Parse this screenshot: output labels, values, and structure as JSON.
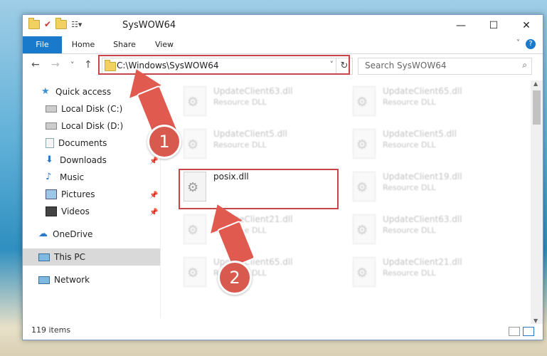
{
  "window": {
    "title": "SysWOW64"
  },
  "window_controls": {
    "minimize": "—",
    "maximize": "☐",
    "close": "✕"
  },
  "ribbon": {
    "tabs": [
      "File",
      "Home",
      "Share",
      "View"
    ],
    "help": "?"
  },
  "nav": {
    "back": "←",
    "forward": "→",
    "recent": "˅",
    "up": "↑"
  },
  "address": {
    "path": "C:\\Windows\\SysWOW64",
    "dropdown": "˅",
    "refresh": "↻"
  },
  "search": {
    "placeholder": "Search SysWOW64",
    "icon": "⌕"
  },
  "sidebar": {
    "items": [
      {
        "label": "Quick access",
        "icon": "star-icon"
      },
      {
        "label": "Local Disk (C:)",
        "icon": "drive-icon"
      },
      {
        "label": "Local Disk (D:)",
        "icon": "drive-icon"
      },
      {
        "label": "Documents",
        "icon": "documents-icon"
      },
      {
        "label": "Downloads",
        "icon": "download-icon"
      },
      {
        "label": "Music",
        "icon": "music-icon"
      },
      {
        "label": "Pictures",
        "icon": "pictures-icon"
      },
      {
        "label": "Videos",
        "icon": "videos-icon"
      },
      {
        "label": "OneDrive",
        "icon": "cloud-icon"
      },
      {
        "label": "This PC",
        "icon": "computer-icon"
      },
      {
        "label": "Network",
        "icon": "network-icon"
      }
    ]
  },
  "files": {
    "left": [
      {
        "name": "UpdateClient63.dll",
        "desc": "Resource DLL"
      },
      {
        "name": "UpdateClient5.dll",
        "desc": "Resource DLL"
      },
      {
        "name": "posix.dll",
        "desc": ""
      },
      {
        "name": "UpdateClient21.dll",
        "desc": "Resource DLL"
      },
      {
        "name": "UpdateClient65.dll",
        "desc": "Resource DLL"
      }
    ],
    "right": [
      {
        "name": "UpdateClient65.dll",
        "desc": "Resource DLL"
      },
      {
        "name": "UpdateClient5.dll",
        "desc": "Resource DLL"
      },
      {
        "name": "UpdateClient19.dll",
        "desc": "Resource DLL"
      },
      {
        "name": "UpdateClient63.dll",
        "desc": "Resource DLL"
      },
      {
        "name": "UpdateClient21.dll",
        "desc": "Resource DLL"
      }
    ]
  },
  "status": {
    "count": "119 items"
  },
  "annotations": {
    "step1": "1",
    "step2": "2"
  },
  "colors": {
    "accent": "#1979ca",
    "highlight": "#c8454a",
    "arrow": "#e05a50"
  }
}
